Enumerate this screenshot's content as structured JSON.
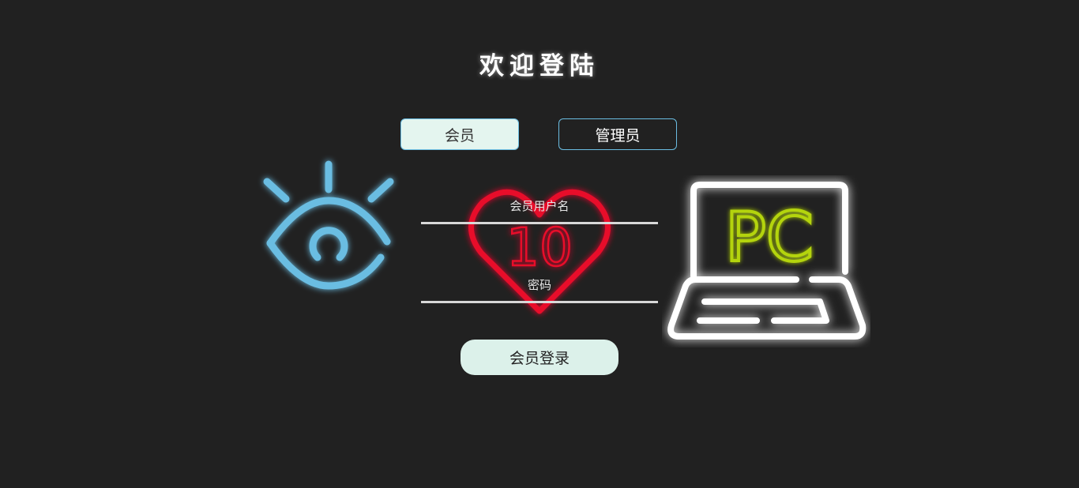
{
  "header": {
    "title": "欢迎登陆"
  },
  "tabs": {
    "member_label": "会员",
    "admin_label": "管理员"
  },
  "form": {
    "username_label": "会员用户名",
    "username_value": "",
    "password_label": "密码",
    "password_value": "",
    "submit_label": "会员登录"
  },
  "decor": {
    "eye_icon": "eye-icon",
    "heart_icon": "heart-icon",
    "heart_text": "10",
    "laptop_icon": "laptop-icon",
    "laptop_text": "PC"
  },
  "colors": {
    "background": "#212121",
    "eye": "#6bbde2",
    "heart": "#e8102a",
    "laptop_frame": "#ffffff",
    "laptop_text": "#b4d411",
    "tab_active_bg": "#e4f5ef",
    "button_bg": "#dcf1ea"
  }
}
